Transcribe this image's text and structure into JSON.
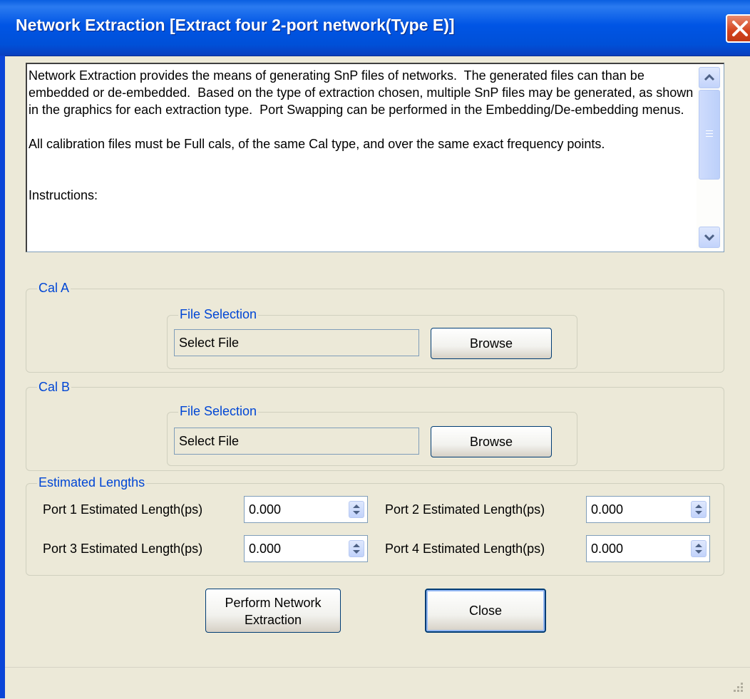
{
  "window": {
    "title": "Network Extraction [Extract four 2-port network(Type E)]"
  },
  "description": {
    "text": "Network Extraction provides the means of generating SnP files of networks.  The generated files can than be embedded or de-embedded.  Based on the type of extraction chosen, multiple SnP files may be generated, as shown in the graphics for each extraction type.  Port Swapping can be performed in the Embedding/De-embedding menus.\n\nAll calibration files must be Full cals, of the same Cal type, and over the same exact frequency points.\n\n\nInstructions:"
  },
  "cal_a": {
    "legend": "Cal A",
    "file_selection": {
      "legend": "File Selection",
      "value": "Select File",
      "browse_label": "Browse"
    }
  },
  "cal_b": {
    "legend": "Cal B",
    "file_selection": {
      "legend": "File Selection",
      "value": "Select File",
      "browse_label": "Browse"
    }
  },
  "estimated_lengths": {
    "legend": "Estimated Lengths",
    "ports": [
      {
        "label": "Port 1 Estimated Length(ps)",
        "value": "0.000"
      },
      {
        "label": "Port 2 Estimated Length(ps)",
        "value": "0.000"
      },
      {
        "label": "Port 3 Estimated Length(ps)",
        "value": "0.000"
      },
      {
        "label": "Port 4 Estimated Length(ps)",
        "value": "0.000"
      }
    ]
  },
  "actions": {
    "perform_label": "Perform Network Extraction",
    "close_label": "Close"
  },
  "colors": {
    "titlebar": "#0055e5",
    "group_legend": "#0046d5",
    "background": "#ece9d8"
  }
}
